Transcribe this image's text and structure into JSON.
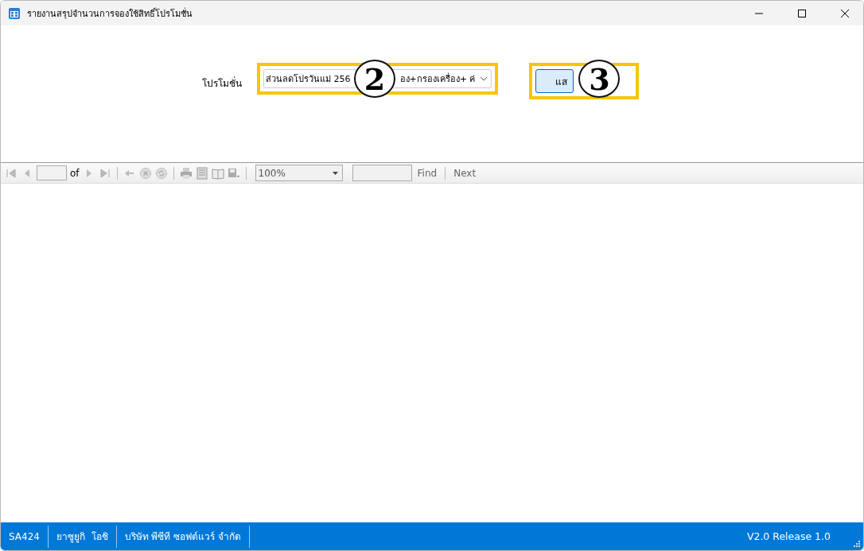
{
  "window": {
    "title": "รายงานสรุปจำนวนการจองใช้สิทธิ์โปรโมชั่น"
  },
  "form": {
    "promotion_label": "โปรโมชั่น",
    "promotion_value_before": "ส่วนลดโปรวันแม่ 256",
    "promotion_value_after": "อง+กรองเครื่อง+ ค่",
    "show_button": "แส"
  },
  "callouts": [
    {
      "number": "2"
    },
    {
      "number": "3"
    }
  ],
  "toolbar": {
    "page_of": "of",
    "zoom": "100%",
    "find": "Find",
    "next": "Next"
  },
  "status_bar": {
    "items": [
      "SA424",
      "ยาซูยูกิ  โอชิ",
      "บริษัท พีซีที ซอฟต์แวร์ จำกัด"
    ],
    "version": "V2.0 Release 1.0"
  }
}
